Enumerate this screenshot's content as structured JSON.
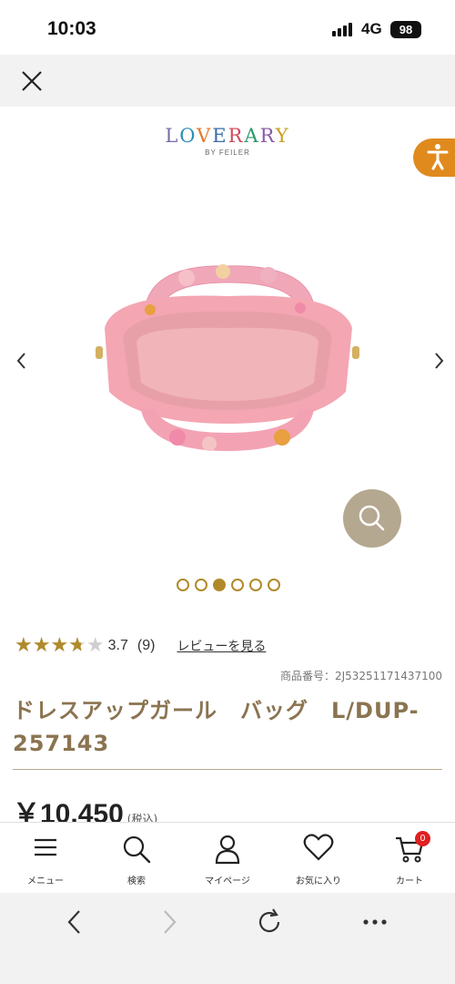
{
  "status": {
    "time": "10:03",
    "network": "4G",
    "battery": "98"
  },
  "brand": {
    "name": "LOVERARY",
    "sub": "BY FEILER"
  },
  "carousel": {
    "total": 6,
    "active_index": 2
  },
  "rating": {
    "stars": 3.7,
    "value": "3.7",
    "count": "(9)",
    "review_link": "レビューを見る"
  },
  "product": {
    "code": "商品番号：2J53251171437100",
    "title": "ドレスアップガール　バッグ　L/DUP-257143",
    "price": "￥10,450",
    "tax": "(税込)"
  },
  "bottom_nav": {
    "items": [
      {
        "label": "メニュー",
        "icon": "menu-icon"
      },
      {
        "label": "検索",
        "icon": "search-icon"
      },
      {
        "label": "マイページ",
        "icon": "user-icon"
      },
      {
        "label": "お気に入り",
        "icon": "heart-icon"
      },
      {
        "label": "カート",
        "icon": "cart-icon"
      }
    ],
    "cart_count": "0"
  },
  "colors": {
    "accent": "#b08a2a",
    "title": "#8a7450",
    "a11y": "#e08a1e",
    "zoom": "#b5a890",
    "badge": "#e02020"
  }
}
